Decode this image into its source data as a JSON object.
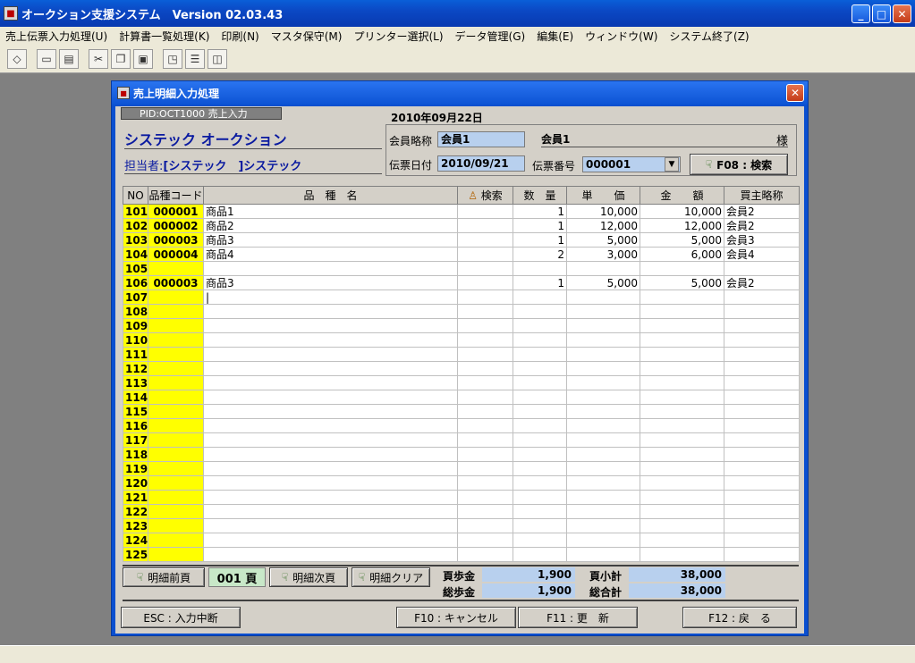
{
  "app": {
    "title": "オークション支援システム　Version 02.03.43"
  },
  "menu": [
    "売上伝票入力処理(U)",
    "計算書一覧処理(K)",
    "印刷(N)",
    "マスタ保守(M)",
    "プリンター選択(L)",
    "データ管理(G)",
    "編集(E)",
    "ウィンドウ(W)",
    "システム終了(Z)"
  ],
  "window": {
    "title": "売上明細入力処理"
  },
  "form": {
    "pid": "PID:OCT1000 売上入力",
    "date": "2010年09月22日",
    "company": "システック オークション",
    "staff_label": "担当者:",
    "staff_value": "[システック　]システック",
    "member_label": "会員略称",
    "member_value": "会員1",
    "member_name": "会員1",
    "honorific": "様",
    "slip_date_label": "伝票日付",
    "slip_date": "2010/09/21",
    "slip_no_label": "伝票番号",
    "slip_no": "000001",
    "search_button": "F08 : 検索"
  },
  "grid": {
    "headers": {
      "no": "NO",
      "code": "品種コード",
      "name": "品　種　名",
      "search": "検索",
      "qty": "数　量",
      "price": "単　　価",
      "amount": "金　　額",
      "buyer": "買主略称"
    },
    "rows": [
      {
        "no": "101",
        "code": "000001",
        "name": "商品1",
        "qty": "1",
        "price": "10,000",
        "amount": "10,000",
        "buyer": "会員2"
      },
      {
        "no": "102",
        "code": "000002",
        "name": "商品2",
        "qty": "1",
        "price": "12,000",
        "amount": "12,000",
        "buyer": "会員2"
      },
      {
        "no": "103",
        "code": "000003",
        "name": "商品3",
        "qty": "1",
        "price": "5,000",
        "amount": "5,000",
        "buyer": "会員3"
      },
      {
        "no": "104",
        "code": "000004",
        "name": "商品4",
        "qty": "2",
        "price": "3,000",
        "amount": "6,000",
        "buyer": "会員4"
      },
      {
        "no": "105",
        "code": "",
        "name": "",
        "qty": "",
        "price": "",
        "amount": "",
        "buyer": ""
      },
      {
        "no": "106",
        "code": "000003",
        "name": "商品3",
        "qty": "1",
        "price": "5,000",
        "amount": "5,000",
        "buyer": "会員2"
      },
      {
        "no": "107",
        "code": "",
        "name": "|",
        "qty": "",
        "price": "",
        "amount": "",
        "buyer": ""
      },
      {
        "no": "108"
      },
      {
        "no": "109"
      },
      {
        "no": "110"
      },
      {
        "no": "111"
      },
      {
        "no": "112"
      },
      {
        "no": "113"
      },
      {
        "no": "114"
      },
      {
        "no": "115"
      },
      {
        "no": "116"
      },
      {
        "no": "117"
      },
      {
        "no": "118"
      },
      {
        "no": "119"
      },
      {
        "no": "120"
      },
      {
        "no": "121"
      },
      {
        "no": "122"
      },
      {
        "no": "123"
      },
      {
        "no": "124"
      },
      {
        "no": "125"
      }
    ]
  },
  "footer": {
    "prev_page": "明細前頁",
    "page": "001 頁",
    "next_page": "明細次頁",
    "clear": "明細クリア",
    "page_fee_label": "頁歩金",
    "page_fee": "1,900",
    "page_subtotal_label": "頁小計",
    "page_subtotal": "38,000",
    "total_fee_label": "総歩金",
    "total_fee": "1,900",
    "grand_total_label": "総合計",
    "grand_total": "38,000"
  },
  "fkeys": {
    "esc": "ESC : 入力中断",
    "f10": "F10 : キャンセル",
    "f11": "F11 : 更　新",
    "f12": "F12 : 戻　る"
  }
}
